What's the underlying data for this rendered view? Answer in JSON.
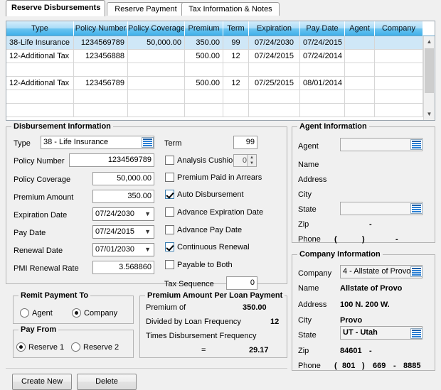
{
  "tabs": [
    {
      "label": "Reserve Disbursements",
      "active": true
    },
    {
      "label": "Reserve Payment",
      "active": false
    },
    {
      "label": "Tax Information & Notes",
      "active": false
    }
  ],
  "grid": {
    "columns": [
      "Type",
      "Policy Number",
      "Policy Coverage",
      "Premium",
      "Term",
      "Expiration",
      "Pay Date",
      "Agent",
      "Company"
    ],
    "rows": [
      {
        "type": "38-Life Insurance",
        "policy_number": "1234569789",
        "policy_coverage": "50,000.00",
        "premium": "350.00",
        "term": "99",
        "expiration": "07/24/2030",
        "pay_date": "07/24/2015",
        "agent": "",
        "company": "",
        "selected": true
      },
      {
        "type": "12-Additional Tax",
        "policy_number": "123456888",
        "policy_coverage": "",
        "premium": "500.00",
        "term": "12",
        "expiration": "07/24/2015",
        "pay_date": "07/24/2014",
        "agent": "",
        "company": "",
        "selected": false
      },
      {
        "type": "",
        "policy_number": "",
        "policy_coverage": "",
        "premium": "",
        "term": "",
        "expiration": "",
        "pay_date": "",
        "agent": "",
        "company": "",
        "selected": false
      },
      {
        "type": "12-Additional Tax",
        "policy_number": "123456789",
        "policy_coverage": "",
        "premium": "500.00",
        "term": "12",
        "expiration": "07/25/2015",
        "pay_date": "08/01/2014",
        "agent": "",
        "company": "",
        "selected": false
      },
      {
        "type": "",
        "policy_number": "",
        "policy_coverage": "",
        "premium": "",
        "term": "",
        "expiration": "",
        "pay_date": "",
        "agent": "",
        "company": "",
        "selected": false
      },
      {
        "type": "",
        "policy_number": "",
        "policy_coverage": "",
        "premium": "",
        "term": "",
        "expiration": "",
        "pay_date": "",
        "agent": "",
        "company": "",
        "selected": false
      }
    ],
    "scroll_up_icon": "chevron-up",
    "scroll_down_icon": "chevron-down"
  },
  "disbursement": {
    "title": "Disbursement Information",
    "type_label": "Type",
    "type_value": "38 - Life Insurance",
    "policy_number_label": "Policy Number",
    "policy_number_value": "1234569789",
    "policy_coverage_label": "Policy Coverage",
    "policy_coverage_value": "50,000.00",
    "premium_amount_label": "Premium Amount",
    "premium_amount_value": "350.00",
    "expiration_date_label": "Expiration Date",
    "expiration_date_value": "07/24/2030",
    "pay_date_label": "Pay Date",
    "pay_date_value": "07/24/2015",
    "renewal_date_label": "Renewal Date",
    "renewal_date_value": "07/01/2030",
    "pmi_renewal_rate_label": "PMI Renewal Rate",
    "pmi_renewal_rate_value": "3.568860",
    "term_label": "Term",
    "term_value": "99",
    "analysis_cushion_label": "Analysis Cushion",
    "analysis_cushion_value": "0",
    "analysis_cushion_checked": false,
    "premium_paid_in_arrears_label": "Premium Paid in Arrears",
    "premium_paid_in_arrears_checked": false,
    "auto_disbursement_label": "Auto Disbursement",
    "auto_disbursement_checked": true,
    "advance_expiration_date_label": "Advance Expiration Date",
    "advance_expiration_date_checked": false,
    "advance_pay_date_label": "Advance Pay Date",
    "advance_pay_date_checked": false,
    "continuous_renewal_label": "Continuous Renewal",
    "continuous_renewal_checked": true,
    "payable_to_both_label": "Payable to Both",
    "payable_to_both_checked": false,
    "tax_sequence_label": "Tax Sequence",
    "tax_sequence_value": "0"
  },
  "remit": {
    "title": "Remit Payment To",
    "agent_label": "Agent",
    "company_label": "Company",
    "selected": "Company"
  },
  "pay_from": {
    "title": "Pay From",
    "reserve1_label": "Reserve 1",
    "reserve2_label": "Reserve 2",
    "selected": "Reserve 1"
  },
  "premium_per_loan": {
    "title": "Premium Amount Per Loan Payment",
    "premium_of_label": "Premium of",
    "premium_of_value": "350.00",
    "divided_by_label": "Divided by Loan Frequency",
    "divided_by_value": "12",
    "times_label": "Times Disbursement Frequency",
    "times_value": "",
    "equals_label": "=",
    "equals_value": "29.17"
  },
  "agent_info": {
    "title": "Agent Information",
    "agent_label": "Agent",
    "agent_value": "",
    "name_label": "Name",
    "name_value": "",
    "address_label": "Address",
    "address_value": "",
    "city_label": "City",
    "city_value": "",
    "state_label": "State",
    "state_value": "",
    "zip_label": "Zip",
    "zip_value": "",
    "zip_dash": "-",
    "phone_label": "Phone",
    "phone_open": "(",
    "phone_area": "",
    "phone_close": ")",
    "phone_prefix": "",
    "phone_dash": "-",
    "phone_line": ""
  },
  "company_info": {
    "title": "Company Information",
    "company_label": "Company",
    "company_value": "4 - Allstate of Provo",
    "name_label": "Name",
    "name_value": "Allstate of Provo",
    "address_label": "Address",
    "address_value": "100 N. 200 W.",
    "city_label": "City",
    "city_value": "Provo",
    "state_label": "State",
    "state_value": "UT - Utah",
    "zip_label": "Zip",
    "zip_value": "84601",
    "zip_dash": "-",
    "zip_ext": "",
    "phone_label": "Phone",
    "phone_open": "(",
    "phone_area": "801",
    "phone_close": ")",
    "phone_prefix": "669",
    "phone_dash": "-",
    "phone_line": "8885"
  },
  "footer": {
    "create_new_label": "Create New",
    "delete_label": "Delete"
  },
  "icons": {
    "lookup": "list-lookup-icon",
    "dropdown": "chevron-down-icon"
  },
  "colors": {
    "header_blue": "#3fb0ea",
    "selected_row": "#cfe7f7",
    "window_bg": "#f0f0f0"
  }
}
